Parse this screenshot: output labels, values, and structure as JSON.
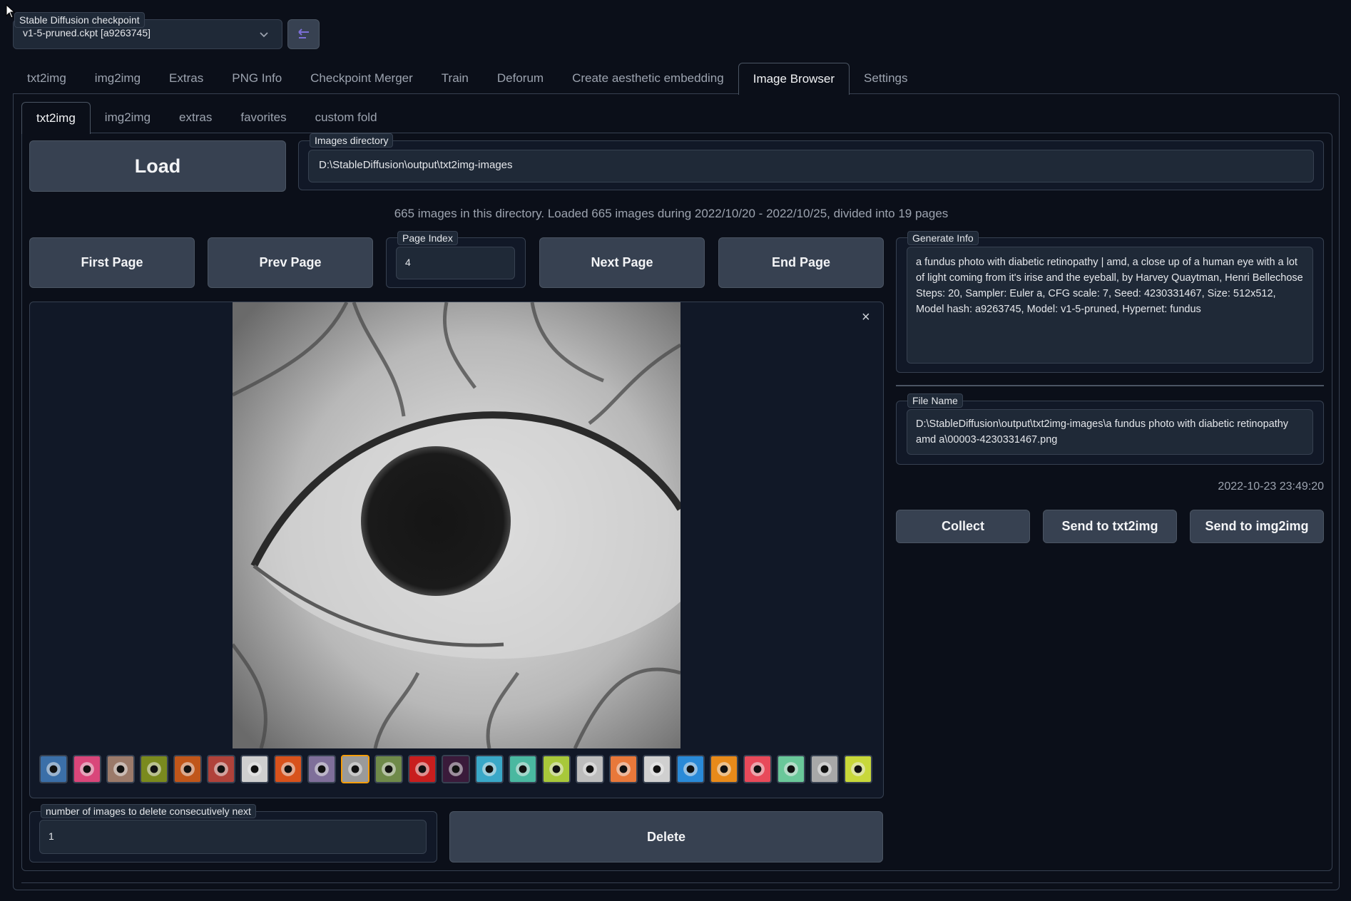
{
  "checkpoint": {
    "label": "Stable Diffusion checkpoint",
    "value": "v1-5-pruned.ckpt [a9263745]"
  },
  "main_tabs": [
    "txt2img",
    "img2img",
    "Extras",
    "PNG Info",
    "Checkpoint Merger",
    "Train",
    "Deforum",
    "Create aesthetic embedding",
    "Image Browser",
    "Settings"
  ],
  "main_tab_active": "Image Browser",
  "sub_tabs": [
    "txt2img",
    "img2img",
    "extras",
    "favorites",
    "custom fold"
  ],
  "sub_tab_active": "txt2img",
  "load_button": "Load",
  "images_directory": {
    "label": "Images directory",
    "value": "D:\\StableDiffusion\\output\\txt2img-images"
  },
  "status_text": "665 images in this directory. Loaded 665 images during 2022/10/20 - 2022/10/25, divided into 19 pages",
  "navigation": {
    "first_page": "First Page",
    "prev_page": "Prev Page",
    "page_index_label": "Page Index",
    "page_index_value": "4",
    "next_page": "Next Page",
    "end_page": "End Page"
  },
  "gallery": {
    "close": "×",
    "thumbnails": [
      {
        "name": "thumb-1",
        "color": "#3b6fa8"
      },
      {
        "name": "thumb-2",
        "color": "#d9467a"
      },
      {
        "name": "thumb-3",
        "color": "#9b7a6a"
      },
      {
        "name": "thumb-4",
        "color": "#7a8a1e"
      },
      {
        "name": "thumb-5",
        "color": "#c0561a"
      },
      {
        "name": "thumb-6",
        "color": "#b0423a"
      },
      {
        "name": "thumb-7",
        "color": "#cfcfcf"
      },
      {
        "name": "thumb-8",
        "color": "#d8521c"
      },
      {
        "name": "thumb-9",
        "color": "#7f6f9a"
      },
      {
        "name": "thumb-10",
        "color": "#9a9a9a"
      },
      {
        "name": "thumb-11",
        "color": "#6f8a4a"
      },
      {
        "name": "thumb-12",
        "color": "#c81e1e"
      },
      {
        "name": "thumb-13",
        "color": "#3a1a3a"
      },
      {
        "name": "thumb-14",
        "color": "#3aa8c8"
      },
      {
        "name": "thumb-15",
        "color": "#4ab8a0"
      },
      {
        "name": "thumb-16",
        "color": "#a8c83a"
      },
      {
        "name": "thumb-17",
        "color": "#bdbdbd"
      },
      {
        "name": "thumb-18",
        "color": "#e8783a"
      },
      {
        "name": "thumb-19",
        "color": "#d0d0d0"
      },
      {
        "name": "thumb-20",
        "color": "#2a8ad8"
      },
      {
        "name": "thumb-21",
        "color": "#e88a1a"
      },
      {
        "name": "thumb-22",
        "color": "#e84a5a"
      },
      {
        "name": "thumb-23",
        "color": "#6ac89a"
      },
      {
        "name": "thumb-24",
        "color": "#a8a8a8"
      },
      {
        "name": "thumb-25",
        "color": "#c8d83a"
      }
    ],
    "selected_index": 9
  },
  "delete": {
    "label": "number of images to delete consecutively next",
    "value": "1",
    "button": "Delete"
  },
  "generate_info": {
    "label": "Generate Info",
    "text": "a fundus photo with diabetic retinopathy | amd, a close up of a human eye with a lot of light coming from it's irise and the eyeball, by Harvey Quaytman, Henri Bellechose\nSteps: 20, Sampler: Euler a, CFG scale: 7, Seed: 4230331467, Size: 512x512, Model hash: a9263745, Model: v1-5-pruned, Hypernet: fundus"
  },
  "file_name": {
    "label": "File Name",
    "value": "D:\\StableDiffusion\\output\\txt2img-images\\a fundus photo with diabetic retinopathy amd a\\00003-4230331467.png"
  },
  "timestamp": "2022-10-23 23:49:20",
  "actions": {
    "collect": "Collect",
    "send_txt2img": "Send to txt2img",
    "send_img2img": "Send to img2img"
  },
  "colors": {
    "background": "#0b0f19",
    "panel": "#111827",
    "input": "#1f2937",
    "button": "#374151",
    "border": "#374151",
    "selected_thumb": "#f59e0b"
  }
}
